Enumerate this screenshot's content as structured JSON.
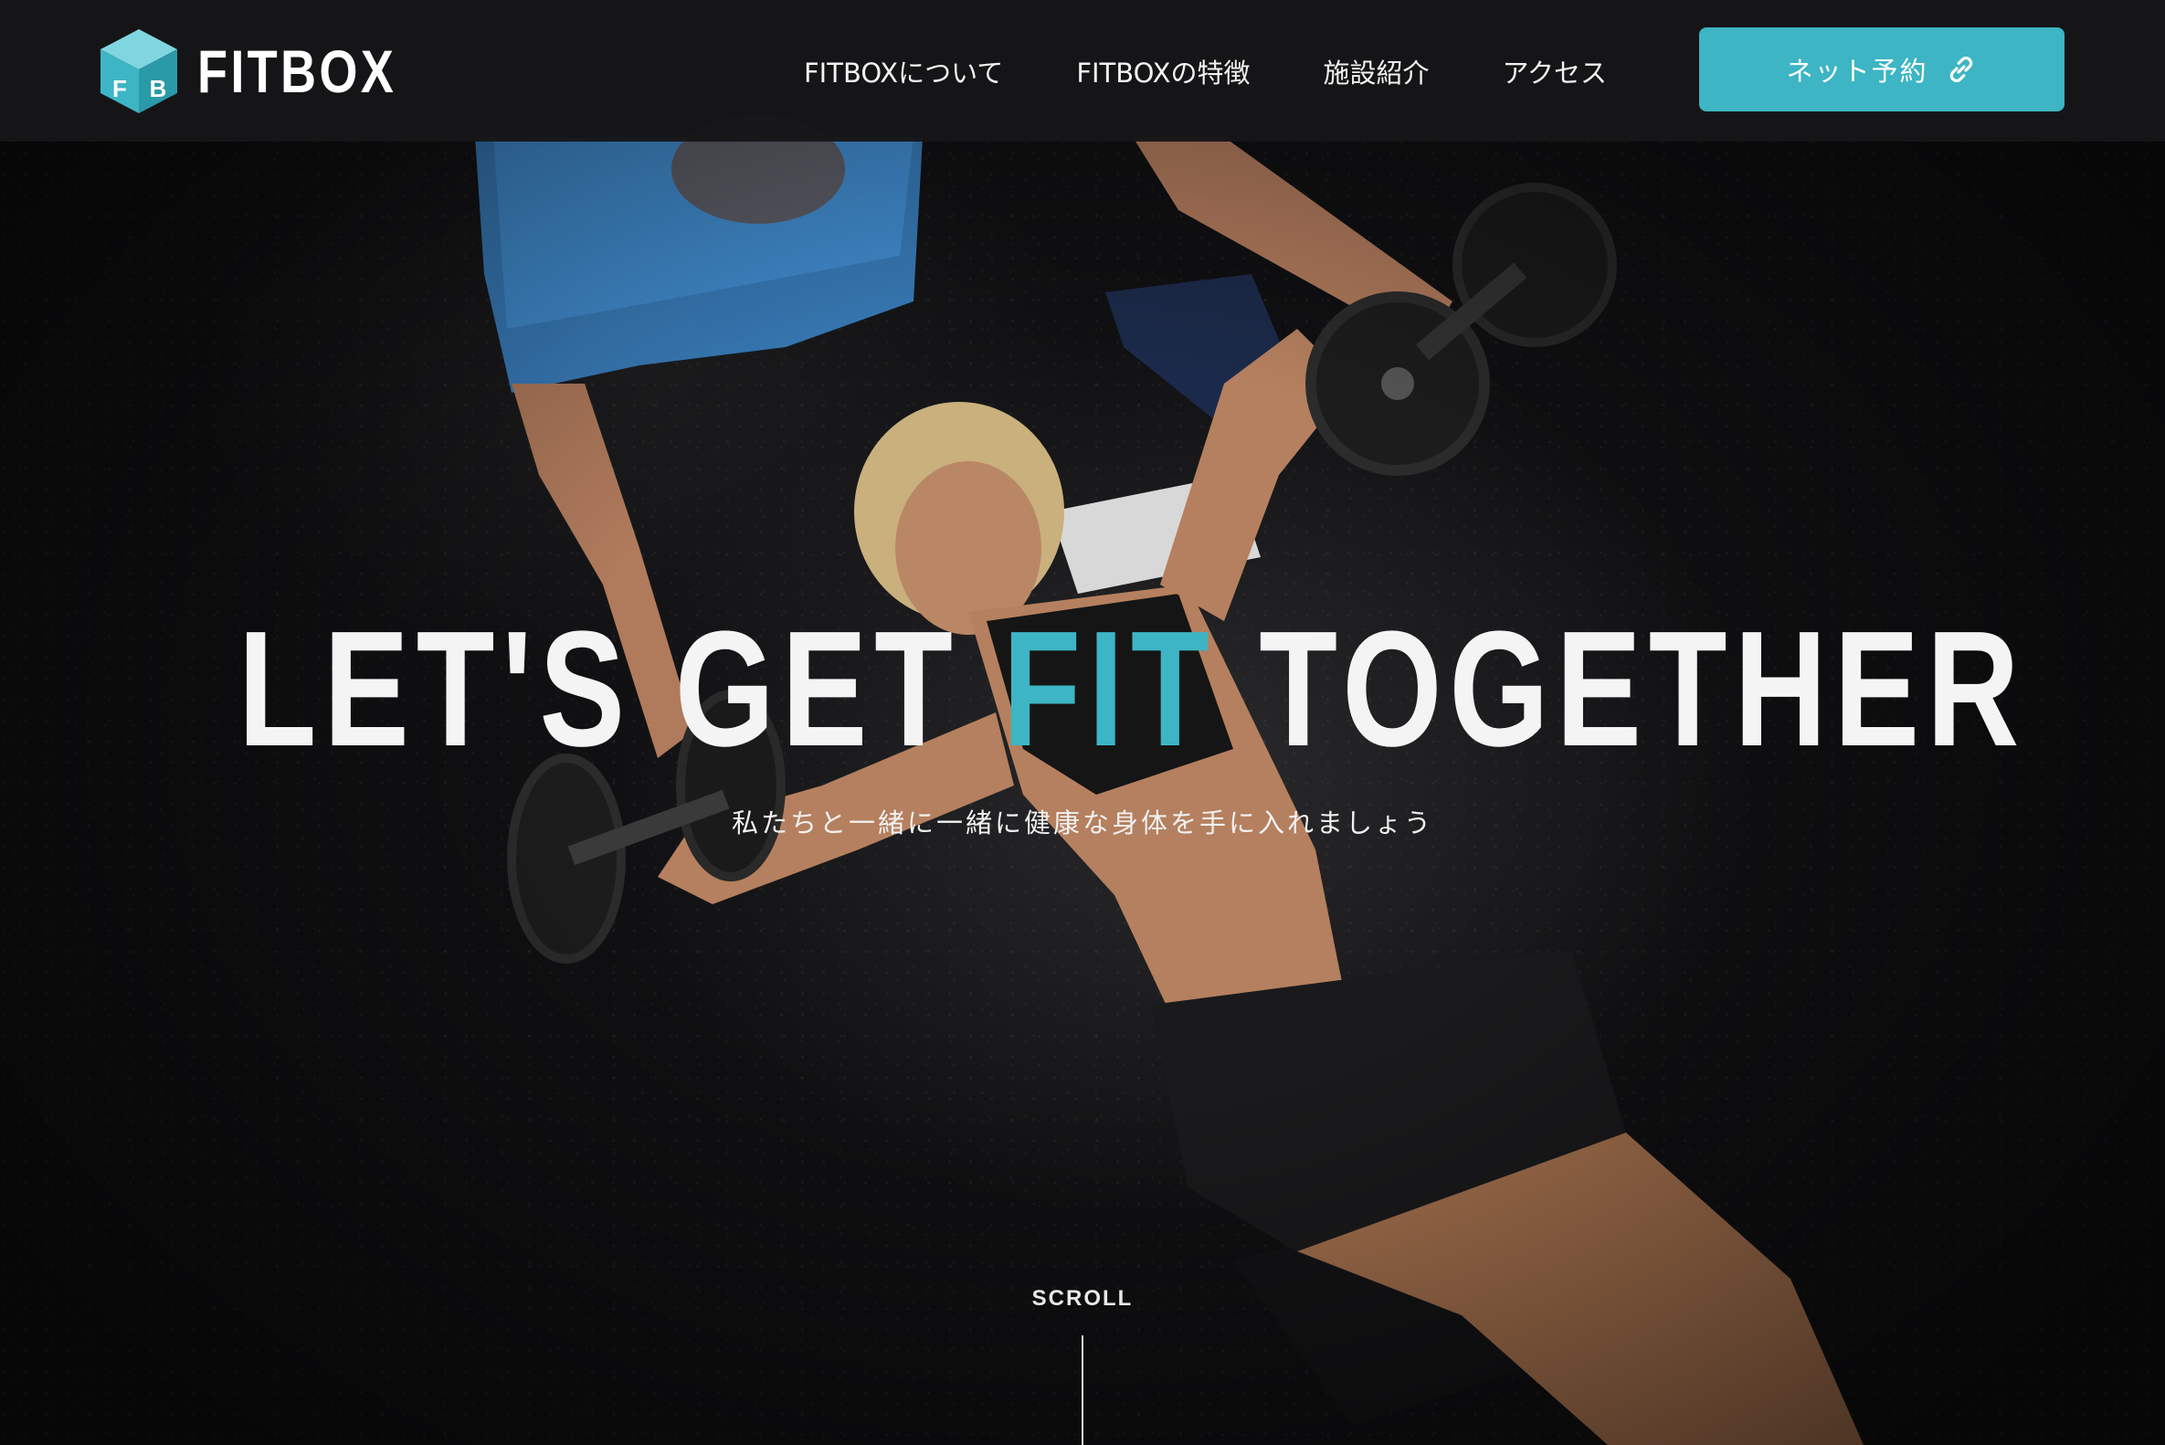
{
  "brand": {
    "name": "FITBOX",
    "cube_letters": [
      "F",
      "B"
    ],
    "accent_color": "#3db5c4"
  },
  "nav": {
    "items": [
      {
        "label": "FITBOXについて"
      },
      {
        "label": "FITBOXの特徴"
      },
      {
        "label": "施設紹介"
      },
      {
        "label": "アクセス"
      }
    ],
    "cta_label": "ネット予約",
    "cta_icon": "link-icon"
  },
  "hero": {
    "headline_before": "LET'S GET ",
    "headline_accent": "FIT",
    "headline_after": " TOGETHER",
    "subtitle": "私たちと一緒に一緒に健康な身体を手に入れましょう",
    "scroll_label": "SCROLL"
  }
}
